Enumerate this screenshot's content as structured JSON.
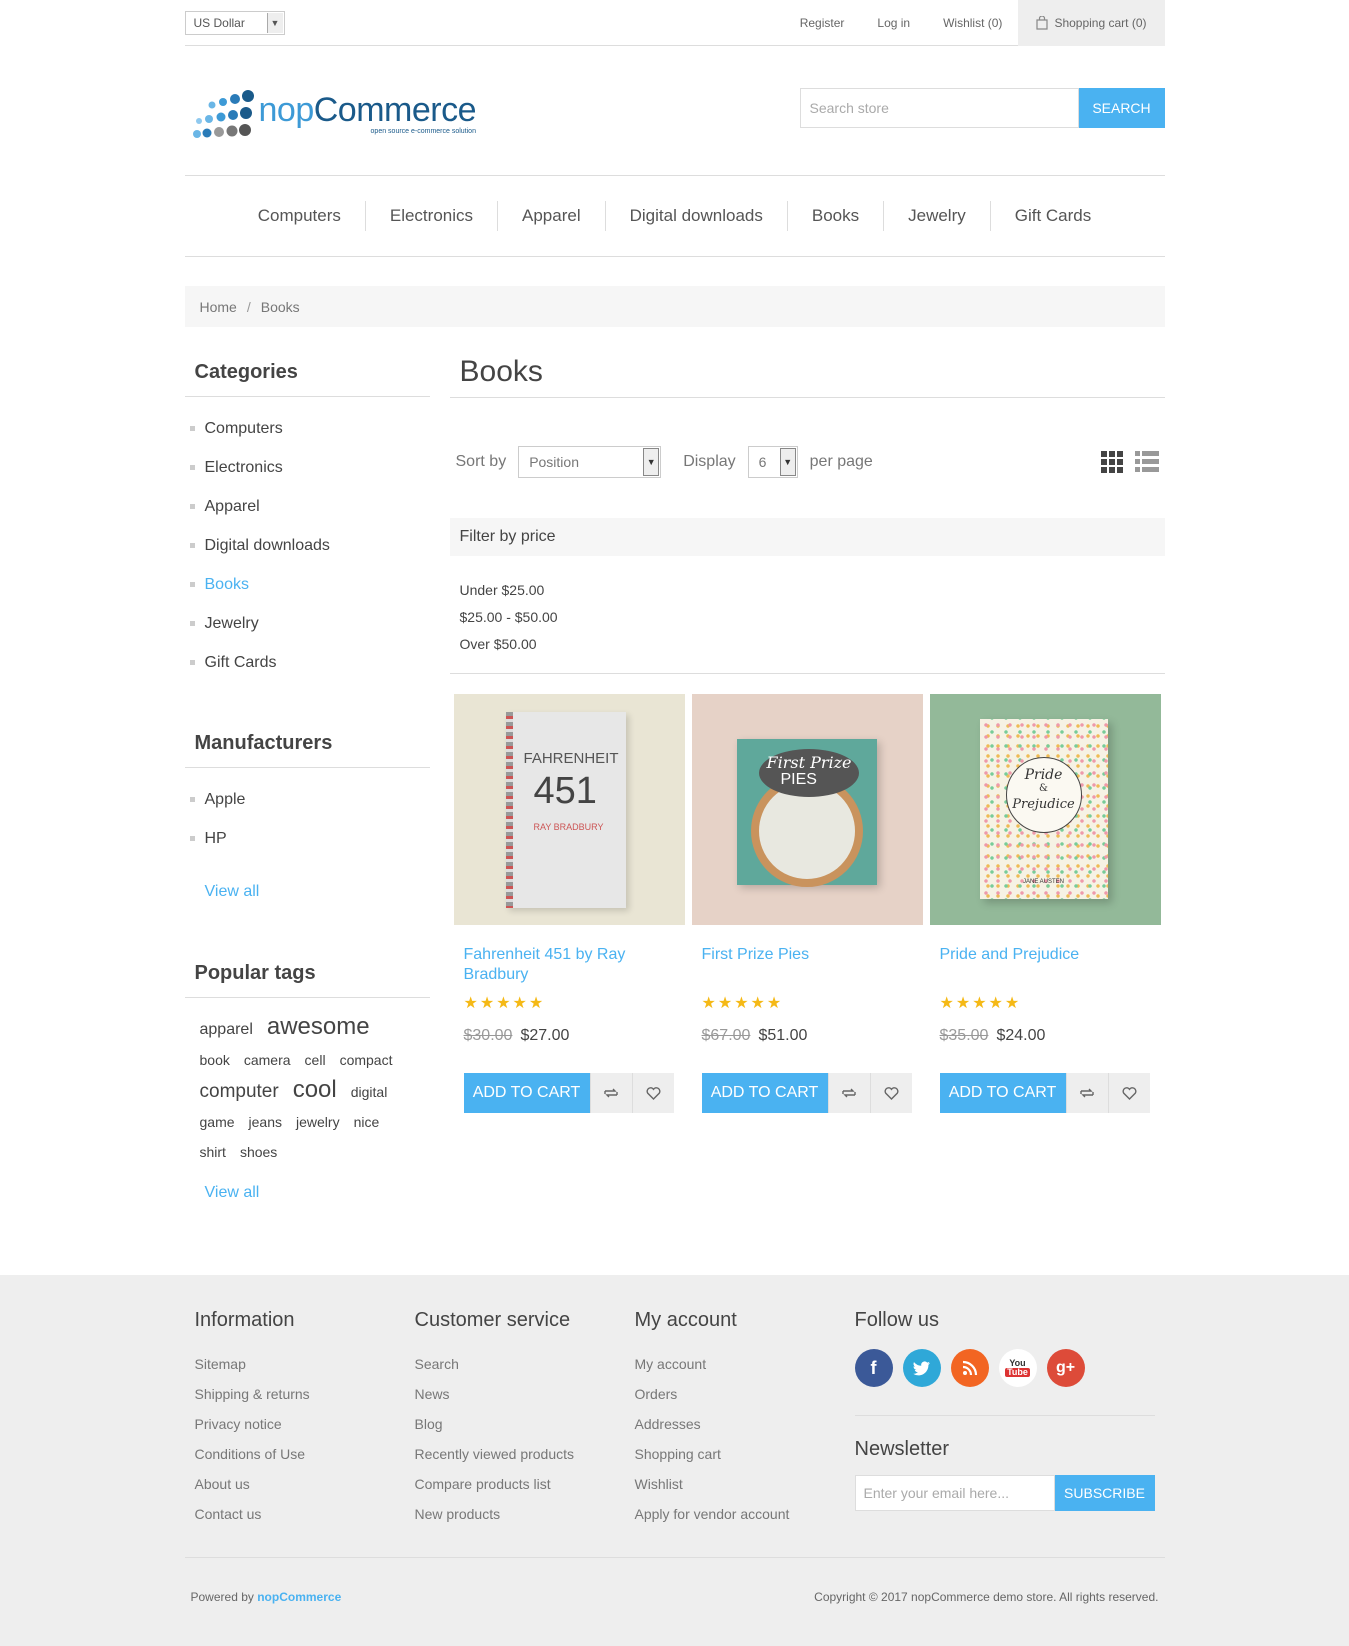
{
  "header": {
    "currency": "US Dollar",
    "links": {
      "register": "Register",
      "login": "Log in",
      "wishlist": "Wishlist (0)",
      "cart": "Shopping cart (0)"
    },
    "logo": {
      "word_a": "nop",
      "word_b": "Commerce",
      "tagline": "open source e-commerce solution"
    },
    "search": {
      "placeholder": "Search store",
      "button": "SEARCH"
    }
  },
  "nav": [
    "Computers",
    "Electronics",
    "Apparel",
    "Digital downloads",
    "Books",
    "Jewelry",
    "Gift Cards"
  ],
  "breadcrumb": {
    "home": "Home",
    "sep": "/",
    "current": "Books"
  },
  "sidebar": {
    "categories_title": "Categories",
    "categories": [
      "Computers",
      "Electronics",
      "Apparel",
      "Digital downloads",
      "Books",
      "Jewelry",
      "Gift Cards"
    ],
    "active_category": "Books",
    "manufacturers_title": "Manufacturers",
    "manufacturers": [
      "Apple",
      "HP"
    ],
    "view_all": "View all",
    "tags_title": "Popular tags",
    "tags": [
      "apparel",
      "awesome",
      "book",
      "camera",
      "cell",
      "compact",
      "computer",
      "cool",
      "digital",
      "game",
      "jeans",
      "jewelry",
      "nice",
      "shirt",
      "shoes"
    ]
  },
  "main": {
    "title": "Books",
    "sort_label": "Sort by",
    "sort_value": "Position",
    "display_label": "Display",
    "display_value": "6",
    "per_page": "per page",
    "filter_title": "Filter by price",
    "filters": [
      "Under $25.00",
      "$25.00 - $50.00",
      "Over $50.00"
    ]
  },
  "products": [
    {
      "name": "Fahrenheit 451 by Ray Bradbury",
      "old_price": "$30.00",
      "price": "$27.00",
      "rating": 5,
      "cover_a": "FAHRENHEIT",
      "cover_b": "451",
      "cover_c": "RAY BRADBURY"
    },
    {
      "name": "First Prize Pies",
      "old_price": "$67.00",
      "price": "$51.00",
      "rating": 5,
      "cover_a": "First Prize",
      "cover_b": "PIES"
    },
    {
      "name": "Pride and Prejudice",
      "old_price": "$35.00",
      "price": "$24.00",
      "rating": 5,
      "cover_a": "Pride",
      "cover_b": "&",
      "cover_c": "Prejudice",
      "cover_d": "JANE AUSTEN"
    }
  ],
  "add_to_cart": "ADD TO CART",
  "footer": {
    "info_title": "Information",
    "info": [
      "Sitemap",
      "Shipping & returns",
      "Privacy notice",
      "Conditions of Use",
      "About us",
      "Contact us"
    ],
    "cs_title": "Customer service",
    "cs": [
      "Search",
      "News",
      "Blog",
      "Recently viewed products",
      "Compare products list",
      "New products"
    ],
    "acc_title": "My account",
    "acc": [
      "My account",
      "Orders",
      "Addresses",
      "Shopping cart",
      "Wishlist",
      "Apply for vendor account"
    ],
    "follow_title": "Follow us",
    "social": [
      "facebook-icon",
      "twitter-icon",
      "rss-icon",
      "youtube-icon",
      "google-plus-icon"
    ],
    "social_text": {
      "facebook": "f",
      "google": "g+",
      "youtube_a": "You",
      "youtube_b": "Tube"
    },
    "newsletter_title": "Newsletter",
    "newsletter_placeholder": "Enter your email here...",
    "subscribe": "SUBSCRIBE",
    "powered_prefix": "Powered by",
    "powered_brand": "nopCommerce",
    "copyright": "Copyright © 2017 nopCommerce demo store. All rights reserved."
  },
  "colors": {
    "accent": "#4ab2f1",
    "facebook": "#3b5998",
    "twitter": "#2fa8d8",
    "rss": "#f26522",
    "google": "#dd4b39"
  }
}
